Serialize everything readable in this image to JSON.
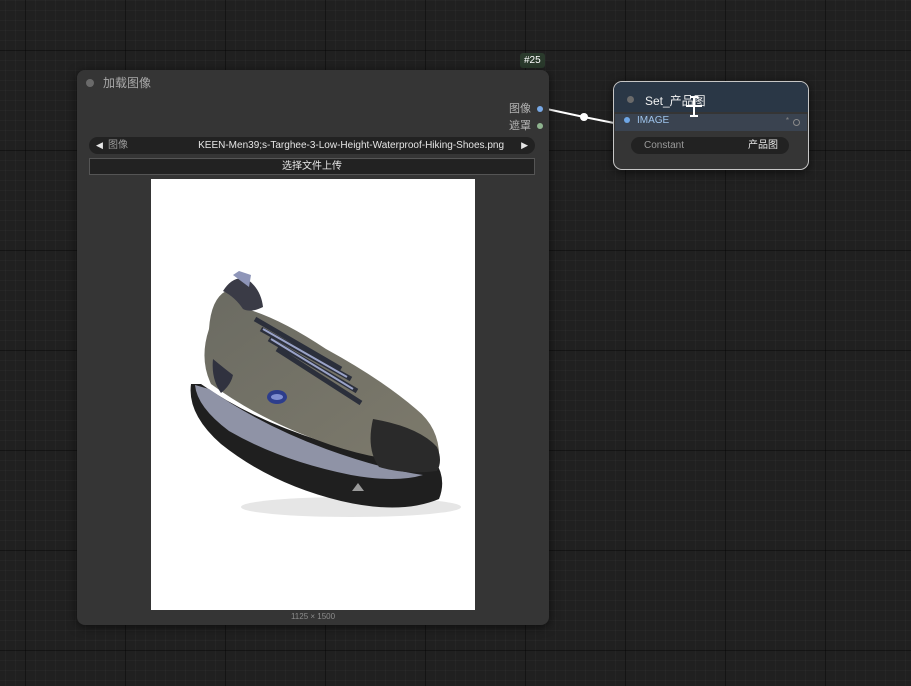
{
  "load_node": {
    "id_badge": "#25",
    "title": "加载图像",
    "outputs": [
      {
        "label": "图像",
        "color": "#78a9e6"
      },
      {
        "label": "遮罩",
        "color": "#8fb48f"
      }
    ],
    "image_widget": {
      "label": "图像",
      "value": "KEEN-Men39;s-Targhee-3-Low-Height-Waterproof-Hiking-Shoes.png",
      "prev_icon": "◀",
      "next_icon": "▶"
    },
    "upload_button": "选择文件上传",
    "preview_dims": "1125 × 1500"
  },
  "set_node": {
    "title": "Set_产品图",
    "input_label": "IMAGE",
    "output_marker": "*",
    "widget_label": "Constant",
    "widget_value": "产品图"
  },
  "colors": {
    "canvas_bg": "#202020",
    "node_bg": "#353535",
    "set_title_bg": "#2a3746",
    "image_slot": "#6fa7e6",
    "link": "#ffffff"
  }
}
